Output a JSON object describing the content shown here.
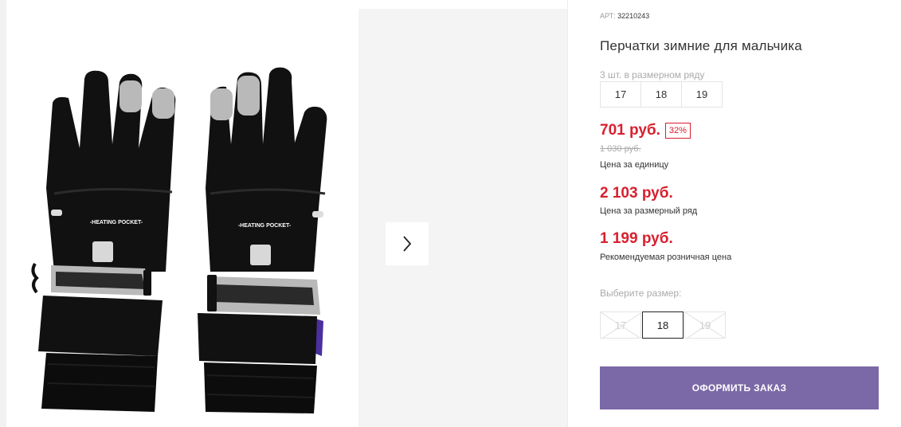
{
  "product": {
    "article_label": "АРТ:",
    "article_value": "32210243",
    "title": "Перчатки зимние для мальчика",
    "image_print": "-HEATING POCKET-"
  },
  "series": {
    "label": "3 шт. в размерном ряду",
    "sizes": [
      "17",
      "18",
      "19"
    ]
  },
  "pricing": {
    "unit_price": "701 руб.",
    "discount": "32%",
    "old_price": "1 030 руб.",
    "unit_note": "Цена за единицу",
    "series_price": "2 103 руб.",
    "series_note": "Цена за размерный ряд",
    "rrp": "1 199 руб.",
    "rrp_note": "Рекомендуемая розничная цена"
  },
  "size_picker": {
    "label": "Выберите размер:",
    "options": [
      {
        "label": "17",
        "state": "unavailable"
      },
      {
        "label": "18",
        "state": "selected"
      },
      {
        "label": "19",
        "state": "unavailable"
      }
    ]
  },
  "actions": {
    "order_label": "ОФОРМИТЬ ЗАКАЗ"
  },
  "gallery": {
    "next_icon": "chevron-right-icon"
  },
  "colors": {
    "price_red": "#d81f2f",
    "button_purple": "#7b68a6",
    "glove_black": "#111111",
    "reflective_grey": "#b9b9b9",
    "lining_purple": "#4a2f9e"
  }
}
